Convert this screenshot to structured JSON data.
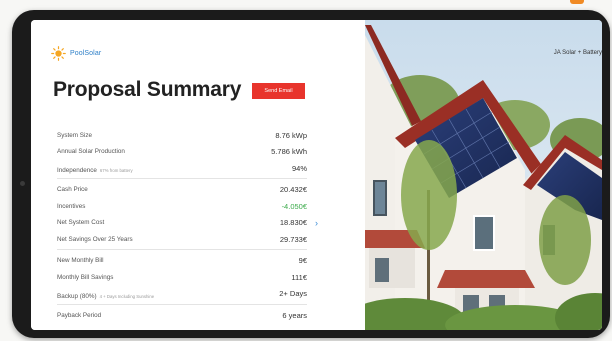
{
  "brand": {
    "name": "PoolSolar"
  },
  "header": {
    "title": "Proposal Summary",
    "send_email_label": "Send Email"
  },
  "photo": {
    "caption": "JA Solar + Battery"
  },
  "rows": [
    {
      "label": "System Size",
      "value": "8.76 kWp"
    },
    {
      "label": "Annual Solar Production",
      "value": "5.786 kWh"
    },
    {
      "label": "Independence",
      "note": "67% from battery",
      "value": "94%"
    },
    {
      "label": "Cash Price",
      "value": "20.432€"
    },
    {
      "label": "Incentives",
      "value": "-4.050€",
      "value_color": "#3cab4b"
    },
    {
      "label": "Net System Cost",
      "value": "18.830€"
    },
    {
      "label": "Net Savings Over 25 Years",
      "value": "29.733€"
    },
    {
      "label": "New Monthly Bill",
      "value": "9€"
    },
    {
      "label": "Monthly Bill Savings",
      "value": "111€"
    },
    {
      "label": "Backup (80%)",
      "note": "4 + Days Including Sunshine",
      "value": "2+ Days"
    },
    {
      "label": "Payback Period",
      "value": "6 years"
    }
  ],
  "colors": {
    "accent": "#e8342c",
    "positive": "#3cab4b",
    "brand": "#2f80c8",
    "frame": "#1b1b1b"
  }
}
